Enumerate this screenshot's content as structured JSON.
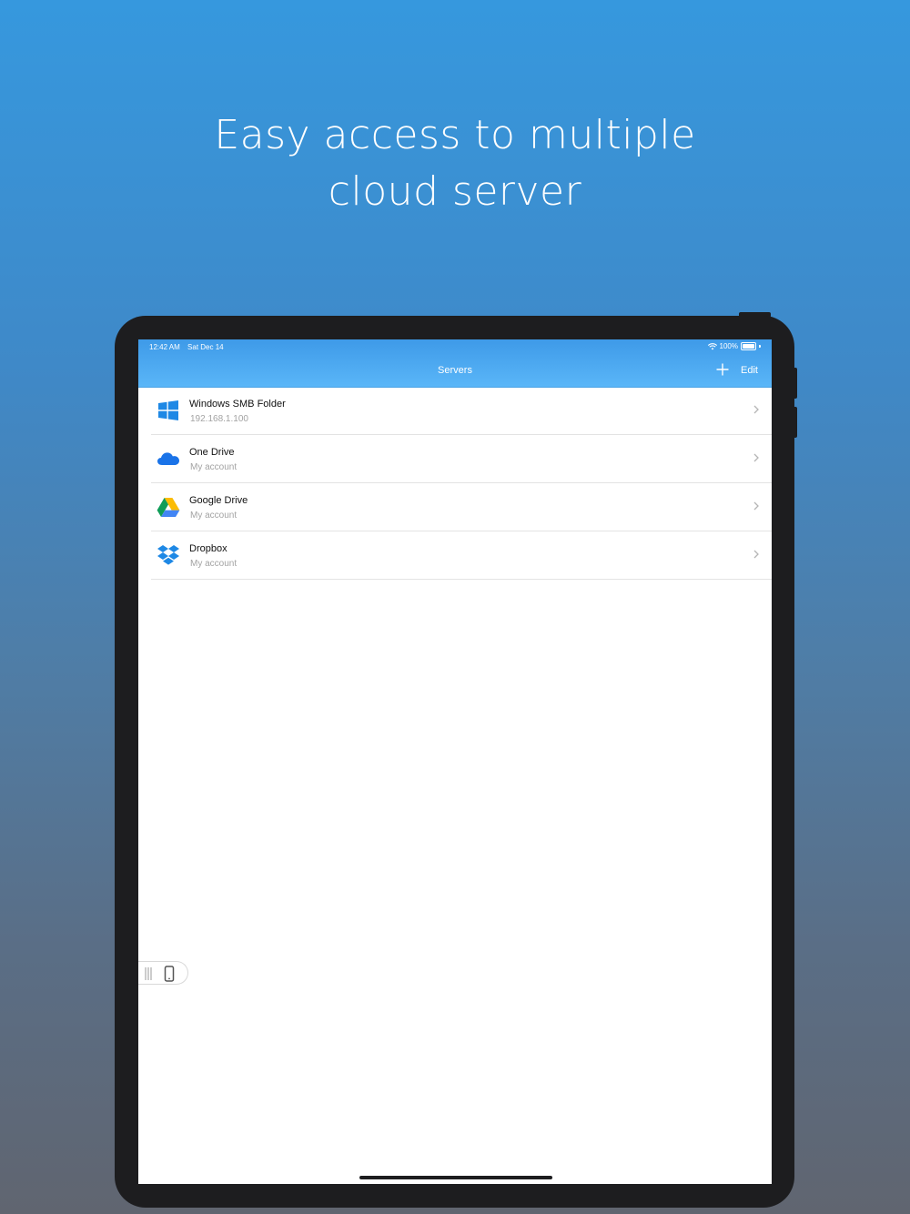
{
  "headline": {
    "line1": "Easy access to multiple",
    "line2": "cloud server"
  },
  "status_bar": {
    "time": "12:42 AM",
    "date": "Sat Dec 14",
    "battery": "100%",
    "icons": [
      "wifi-icon",
      "battery-icon"
    ]
  },
  "navbar": {
    "title": "Servers",
    "add_icon": "plus-icon",
    "edit_label": "Edit"
  },
  "servers": [
    {
      "title": "Windows SMB Folder",
      "subtitle": "192.168.1.100",
      "icon": "windows-icon"
    },
    {
      "title": "One Drive",
      "subtitle": "My account",
      "icon": "onedrive-icon"
    },
    {
      "title": "Google Drive",
      "subtitle": "My account",
      "icon": "google-drive-icon"
    },
    {
      "title": "Dropbox",
      "subtitle": "My account",
      "icon": "dropbox-icon"
    }
  ],
  "colors": {
    "nav_top": "#3e9ae8",
    "nav_bottom": "#5ab6f8",
    "windows_blue": "#1e88e5",
    "onedrive_blue": "#1a73e8",
    "dropbox_blue": "#1e88e5"
  }
}
